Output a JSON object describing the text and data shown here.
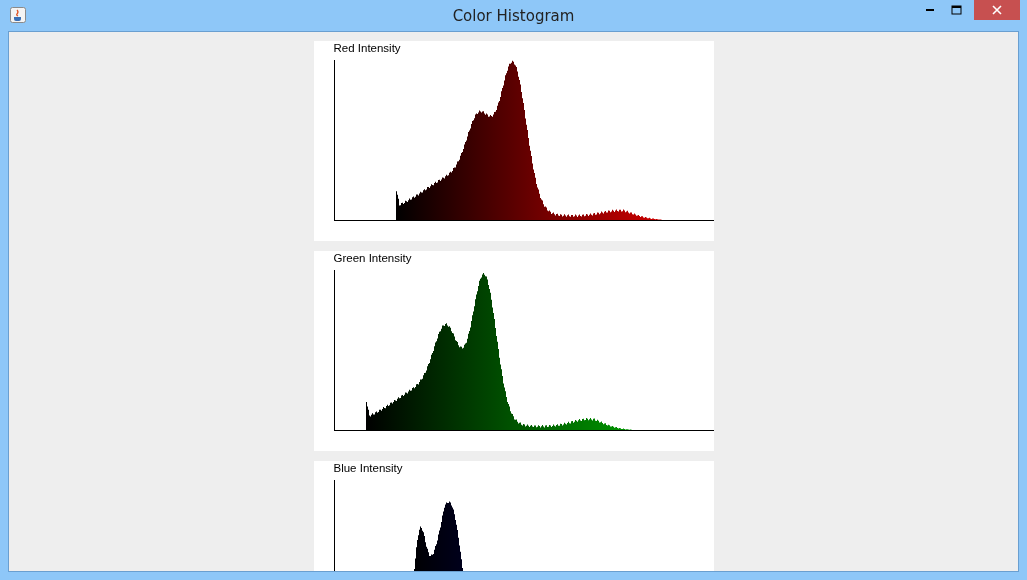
{
  "window": {
    "title": "Color Histogram"
  },
  "panels": [
    {
      "label": "Red Intensity",
      "kind": "red"
    },
    {
      "label": "Green Intensity",
      "kind": "green"
    },
    {
      "label": "Blue Intensity",
      "kind": "blue"
    }
  ]
}
